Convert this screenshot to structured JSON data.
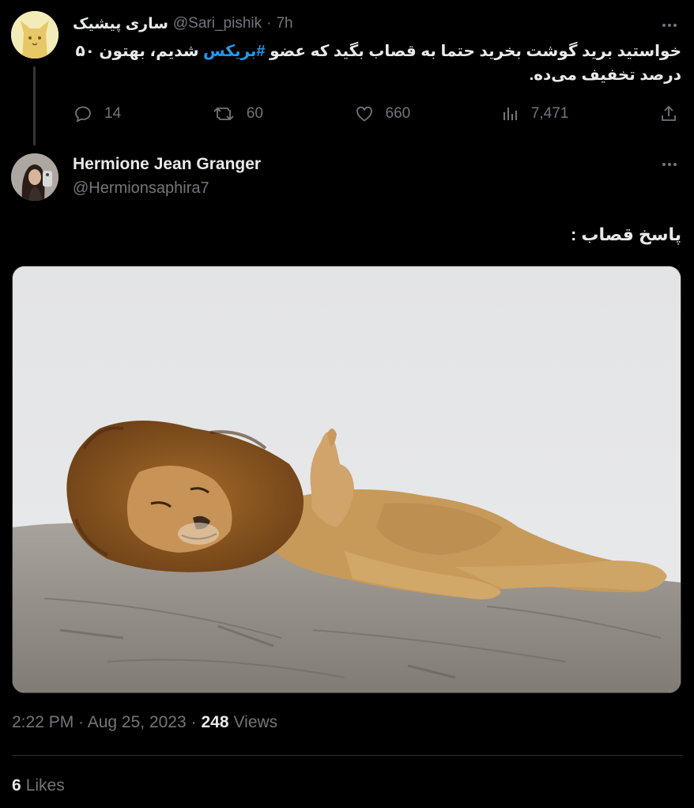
{
  "parent_tweet": {
    "display_name": "ساری پیشیک",
    "handle": "@Sari_pishik",
    "separator": "·",
    "time": "7h",
    "text_before": "خواستید برید گوشت بخرید حتما به قصاب بگید که عضو ",
    "hashtag": "#بریکس",
    "text_after": " شدیم، بهتون ۵۰ درصد تخفیف می‌ده.",
    "stats": {
      "replies": "14",
      "retweets": "60",
      "likes": "660",
      "views": "7,471"
    },
    "icons": [
      "reply-icon",
      "retweet-icon",
      "like-icon",
      "views-icon",
      "share-icon",
      "more-icon"
    ]
  },
  "reply_tweet": {
    "display_name": "Hermione Jean Granger",
    "handle": "@Hermionsaphira7",
    "text": "پاسخ قصاب :",
    "media": "image-lion-on-rock",
    "timestamp": "2:22 PM · Aug 25, 2023 ·",
    "views_count": "248",
    "views_label": "Views",
    "likes_count": "6",
    "likes_label": "Likes"
  },
  "colors": {
    "background": "#000000",
    "text": "#e7e9ea",
    "muted": "#71767b",
    "hashtag": "#1d9bf0",
    "border": "#2f3336"
  }
}
